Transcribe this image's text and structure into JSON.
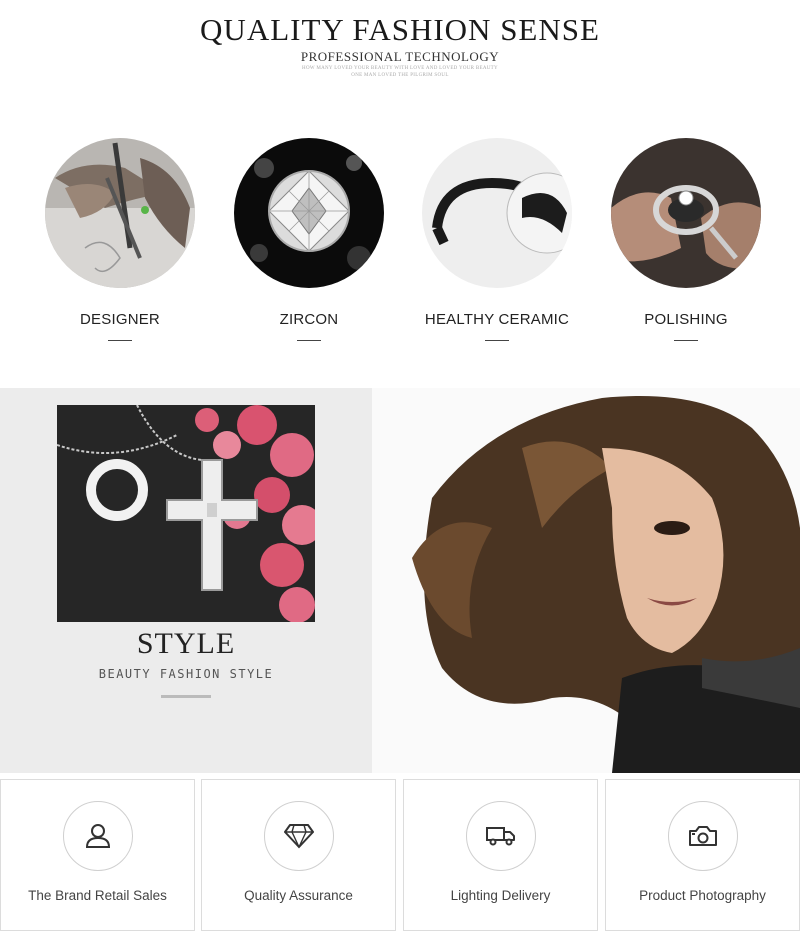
{
  "header": {
    "title": "QUALITY FASHION SENSE",
    "subtitle": "PROFESSIONAL TECHNOLOGY",
    "fine_line_1": "HOW MANY LOVED YOUR BEAUTY WITH LOVE AND LOVED YOUR BEAUTY",
    "fine_line_2": "ONE MAN LOVED THE PILGRIM SOUL"
  },
  "features": [
    {
      "label": "DESIGNER",
      "icon": "designer-sketch-photo"
    },
    {
      "label": "ZIRCON",
      "icon": "zircon-gem-photo"
    },
    {
      "label": "HEALTHY CERAMIC",
      "icon": "ceramic-bangle-photo"
    },
    {
      "label": "POLISHING",
      "icon": "polishing-ring-photo"
    }
  ],
  "style_section": {
    "title": "STYLE",
    "subtitle": "BEAUTY FASHION STYLE"
  },
  "services": [
    {
      "label": "The Brand Retail Sales",
      "icon": "user-icon"
    },
    {
      "label": "Quality Assurance",
      "icon": "diamond-icon"
    },
    {
      "label": "Lighting Delivery",
      "icon": "truck-icon"
    },
    {
      "label": "Product Photography",
      "icon": "camera-icon"
    }
  ],
  "colors": {
    "background": "#ffffff",
    "section_gray": "#ececec",
    "text_dark": "#222222",
    "border": "#dcdcdc"
  }
}
